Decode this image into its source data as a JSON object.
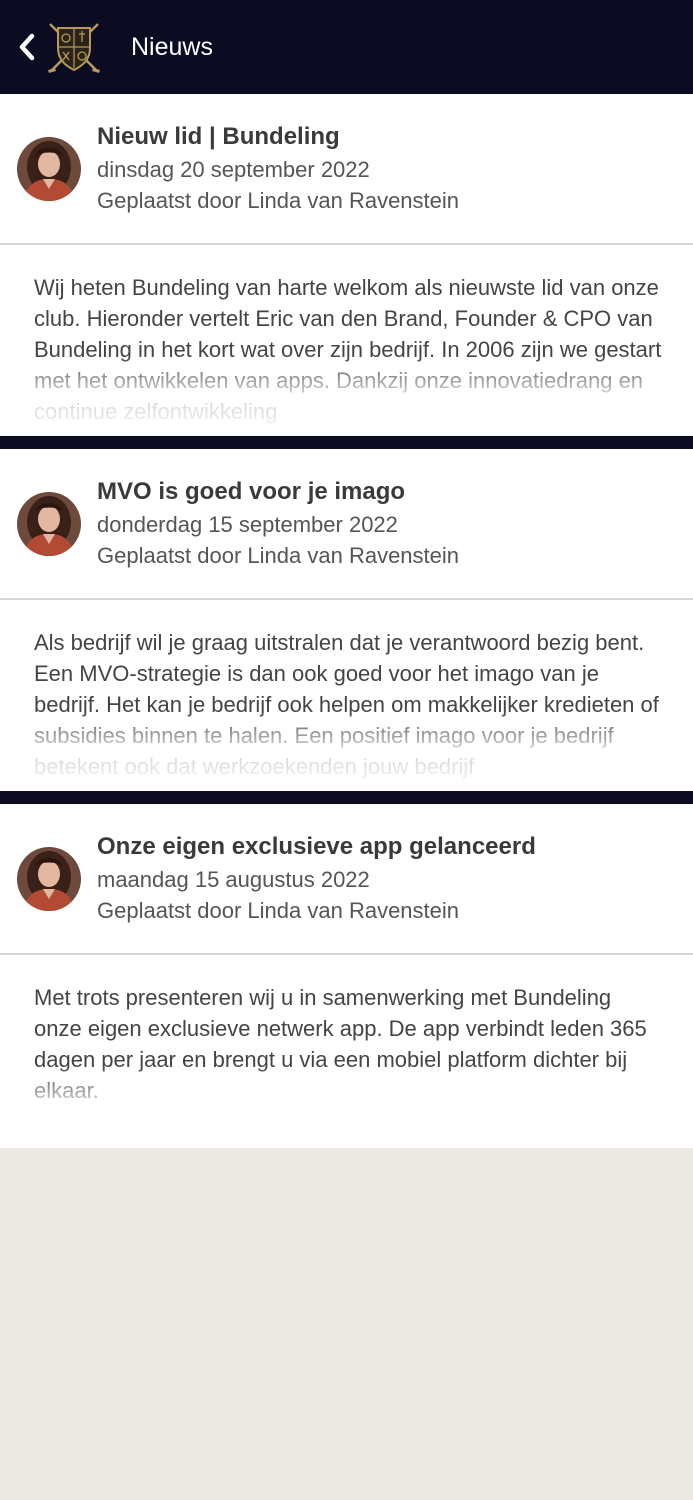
{
  "colors": {
    "header_bg": "#0b0b22",
    "separator": "#0b0b22",
    "card_bg": "#ffffff",
    "page_bg": "#ece9e4",
    "logo_gold": "#b8995a"
  },
  "header": {
    "back_icon": "chevron-left-icon",
    "logo_icon": "club-crest-logo",
    "title": "Nieuws"
  },
  "news": [
    {
      "title": "Nieuw lid | Bundeling",
      "date": "dinsdag 20 september 2022",
      "author": "Geplaatst door Linda van Ravenstein",
      "excerpt": "Wij heten Bundeling van harte welkom als nieuwste lid van onze club. Hieronder vertelt Eric van den Brand, Founder & CPO van Bundeling in het kort wat over zijn bedrijf. In 2006 zijn we gestart met het ontwikkelen van apps. Dankzij onze innovatiedrang en continue zelfontwikkeling"
    },
    {
      "title": "MVO is goed voor je imago",
      "date": "donderdag 15 september 2022",
      "author": "Geplaatst door Linda van Ravenstein",
      "excerpt": "Als bedrijf wil je graag uitstralen dat je verantwoord bezig bent. Een MVO-strategie is dan ook goed voor het imago van je bedrijf. Het kan je bedrijf ook helpen om makkelijker kredieten of subsidies binnen te halen. Een positief imago voor je bedrijf betekent ook dat werkzoekenden jouw bedrijf"
    },
    {
      "title": "Onze eigen exclusieve app gelanceerd",
      "date": "maandag 15 augustus 2022",
      "author": "Geplaatst door Linda van Ravenstein",
      "excerpt": "Met trots presenteren wij u in samenwerking met Bundeling onze eigen exclusieve netwerk app. De app verbindt leden 365 dagen per jaar en brengt u via een mobiel platform dichter bij elkaar."
    }
  ]
}
